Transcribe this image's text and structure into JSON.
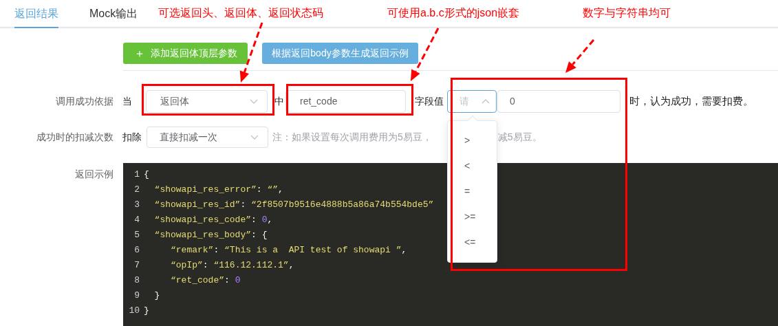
{
  "tabs": [
    {
      "label": "返回结果",
      "selected": true
    },
    {
      "label": "Mock输出",
      "selected": false
    }
  ],
  "toolbar": {
    "buttons": [
      {
        "kind": "add",
        "icon": "＋",
        "label": "添加返回体顶层参数"
      },
      {
        "kind": "generate",
        "label": "根据返回body参数生成返回示例"
      }
    ]
  },
  "success_rule": {
    "label": "调用成功依据",
    "prefix": "当",
    "source_select": {
      "value": "返回体",
      "expanded": false
    },
    "middle": "中",
    "field_input": {
      "value": "ret_code"
    },
    "field_label": "字段值",
    "operator_select": {
      "placeholder": "请",
      "expanded": true,
      "options": [
        {
          "label": ">"
        },
        {
          "label": "<"
        },
        {
          "label": "="
        },
        {
          "label": ">="
        },
        {
          "label": "<="
        }
      ]
    },
    "value_input": {
      "value": "0"
    },
    "suffix": "时，认为成功，需要扣费。"
  },
  "deduction": {
    "label": "成功时的扣减次数",
    "prefix": "扣除",
    "select": {
      "value": "直接扣减一次",
      "expanded": false
    },
    "note_visible_parts": [
      "注：如果设置每次调用费用为5易豆，",
      "减5易豆。"
    ]
  },
  "example": {
    "label": "返回示例",
    "lines": [
      {
        "number": "1",
        "tokens": [
          {
            "kind": "punct",
            "text": "{"
          }
        ]
      },
      {
        "number": "2",
        "tokens": [
          {
            "kind": "string",
            "text": "  “showapi_res_error”"
          },
          {
            "kind": "punct",
            "text": ": "
          },
          {
            "kind": "string",
            "text": "“”"
          },
          {
            "kind": "punct",
            "text": ","
          }
        ]
      },
      {
        "number": "3",
        "tokens": [
          {
            "kind": "string",
            "text": "  “showapi_res_id”"
          },
          {
            "kind": "punct",
            "text": ": "
          },
          {
            "kind": "string",
            "text": "“2f8507b9516e4888b5a86a74b554bde5”"
          }
        ]
      },
      {
        "number": "4",
        "tokens": [
          {
            "kind": "string",
            "text": "  “showapi_res_code”"
          },
          {
            "kind": "punct",
            "text": ": "
          },
          {
            "kind": "number",
            "text": "0"
          },
          {
            "kind": "punct",
            "text": ","
          }
        ]
      },
      {
        "number": "5",
        "tokens": [
          {
            "kind": "string",
            "text": "  “showapi_res_body”"
          },
          {
            "kind": "punct",
            "text": ": {"
          }
        ]
      },
      {
        "number": "6",
        "tokens": [
          {
            "kind": "string",
            "text": "     “remark”"
          },
          {
            "kind": "punct",
            "text": ": "
          },
          {
            "kind": "string",
            "text": "“This is a  API test of showapi ”"
          },
          {
            "kind": "punct",
            "text": ","
          }
        ]
      },
      {
        "number": "7",
        "tokens": [
          {
            "kind": "string",
            "text": "     “opIp”"
          },
          {
            "kind": "punct",
            "text": ": "
          },
          {
            "kind": "string",
            "text": "“116.12.112.1”"
          },
          {
            "kind": "punct",
            "text": ","
          }
        ]
      },
      {
        "number": "8",
        "tokens": [
          {
            "kind": "string",
            "text": "     “ret_code”"
          },
          {
            "kind": "punct",
            "text": ": "
          },
          {
            "kind": "number",
            "text": "0"
          }
        ]
      },
      {
        "number": "9",
        "tokens": [
          {
            "kind": "punct",
            "text": "  }"
          }
        ]
      },
      {
        "number": "10",
        "tokens": [
          {
            "kind": "punct",
            "text": "}"
          }
        ]
      }
    ]
  },
  "annotations": [
    {
      "text": "可选返回头、返回体、返回状态码"
    },
    {
      "text": "可使用a.b.c形式的json嵌套"
    },
    {
      "text": "数字与字符串均可"
    }
  ]
}
